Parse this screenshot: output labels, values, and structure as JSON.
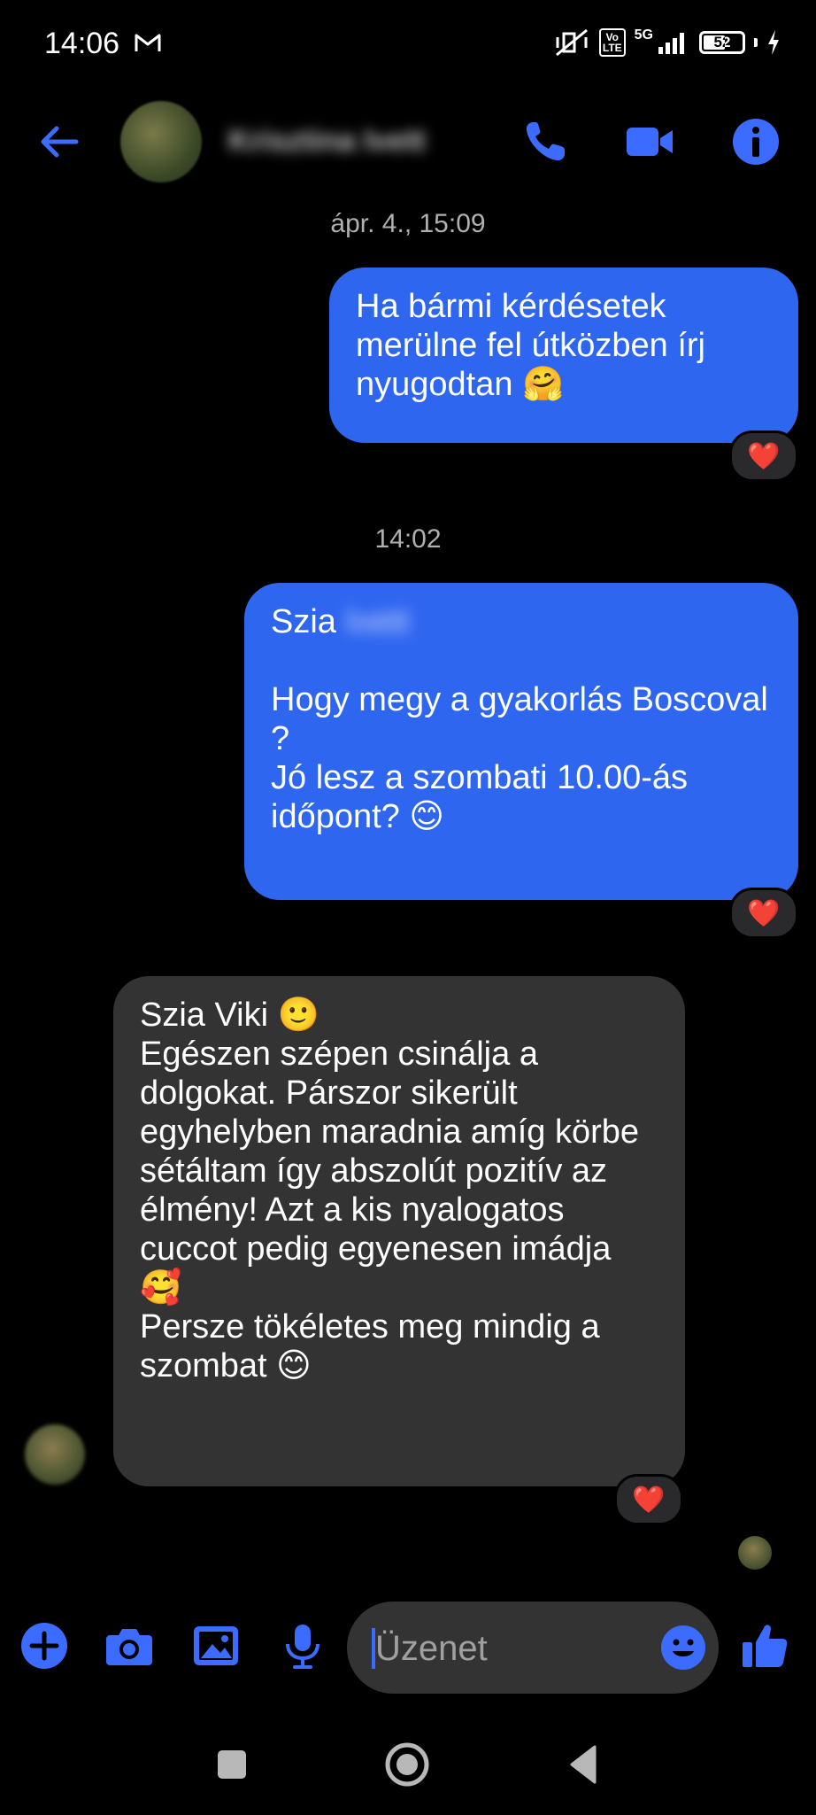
{
  "status_bar": {
    "time": "14:06",
    "network": "5G",
    "volte": "Vo\nLTE",
    "battery": "52"
  },
  "header": {
    "contact_name": "Krisztina Ivett"
  },
  "conversation": {
    "timestamp_1": "ápr. 4., 15:09",
    "msg_1": "Ha bármi kérdésetek merülne fel útközben írj nyugodtan 🤗",
    "timestamp_2": "14:02",
    "msg_2_greeting": "Szia",
    "msg_2_name": "Ivett",
    "msg_2_body": "Hogy megy a gyakorlás Boscoval ?\nJó lesz a szombati 10.00-ás időpont? 😊",
    "msg_3": "Szia Viki 🙂\nEgészen szépen csinálja a dolgokat. Párszor sikerült egyhelyben maradnia amíg körbe sétáltam így abszolút pozitív az élmény! Azt a kis nyalogatos cuccot pedig egyenesen imádja 🥰\nPersze tökéletes meg mindig a szombat 😊",
    "reaction": "❤️"
  },
  "composer": {
    "placeholder": "Üzenet"
  },
  "colors": {
    "accent": "#2f66f0",
    "icon_blue": "#3b6cff",
    "incoming_bubble": "#333334"
  }
}
